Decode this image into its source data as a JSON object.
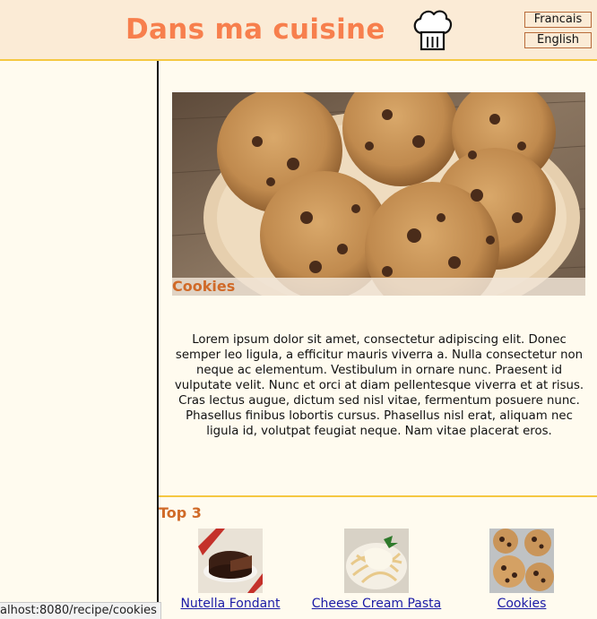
{
  "header": {
    "site_title": "Dans ma cuisine",
    "logo_icon": "chef-hat-icon",
    "languages": [
      {
        "label": "Francais"
      },
      {
        "label": "English"
      }
    ]
  },
  "recipe": {
    "title": "Cookies",
    "description": "Lorem ipsum dolor sit amet, consectetur adipiscing elit. Donec semper leo ligula, a efficitur mauris viverra a. Nulla consectetur non neque ac elementum. Vestibulum in ornare nunc. Praesent id vulputate velit. Nunc et orci at diam pellentesque viverra et at risus. Cras lectus augue, dictum sed nisl vitae, fermentum posuere nunc. Phasellus finibus lobortis cursus. Phasellus nisl erat, aliquam nec ligula id, volutpat feugiat neque. Nam vitae placerat eros."
  },
  "top3": {
    "title": "Top 3",
    "items": [
      {
        "label": "Nutella Fondant"
      },
      {
        "label": "Cheese Cream Pasta"
      },
      {
        "label": "Cookies"
      }
    ]
  },
  "status_bar": {
    "url": "alhost:8080/recipe/cookies"
  },
  "colors": {
    "header_bg": "#fbebd6",
    "title_orange": "#f77f4d",
    "accent_orange": "#d06a28",
    "divider_yellow": "#f5c842",
    "link_blue": "#1a1aa6"
  }
}
